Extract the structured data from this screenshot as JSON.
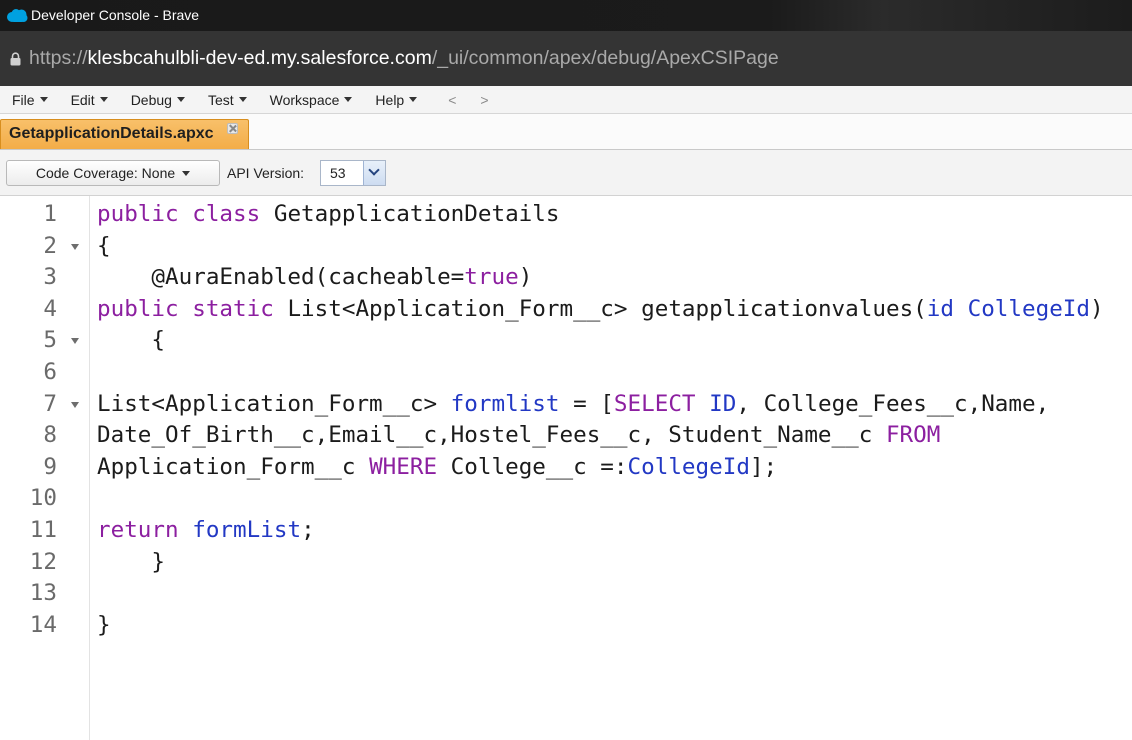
{
  "window": {
    "title": "Developer Console - Brave"
  },
  "address_bar": {
    "scheme": "https://",
    "host": "klesbcahulbli-dev-ed.my.salesforce.com",
    "path": "/_ui/common/apex/debug/ApexCSIPage"
  },
  "menu": {
    "items": [
      {
        "label": "File"
      },
      {
        "label": "Edit"
      },
      {
        "label": "Debug"
      },
      {
        "label": "Test"
      },
      {
        "label": "Workspace"
      },
      {
        "label": "Help"
      }
    ],
    "nav_back": "<",
    "nav_forward": ">"
  },
  "tabs": [
    {
      "label": "GetapplicationDetails.apxc",
      "active": true
    }
  ],
  "toolbar": {
    "coverage_label": "Code Coverage: None",
    "api_version_label": "API Version:",
    "api_version_value": "53"
  },
  "colors": {
    "title_bar": "#1b1b1b",
    "address_bar": "#343434",
    "active_tab": "#f3ad48",
    "keyword": "#8c1fa0",
    "identifier": "#2238c4",
    "code_text": "#1b1b1b",
    "line_number": "#6a6a6a"
  },
  "icons": {
    "app": "salesforce-cloud-icon",
    "address_security": "lock-icon",
    "menu_dropdown": "chevron-down-icon",
    "tab_close": "close-icon",
    "code_fold": "fold-arrow-icon",
    "api_dropdown": "chevron-down-icon"
  },
  "editor": {
    "lines": [
      {
        "number": "1",
        "fold": false,
        "tokens": [
          {
            "text": "public class",
            "color": "#8c1fa0"
          },
          {
            "text": " GetapplicationDetails"
          }
        ]
      },
      {
        "number": "2",
        "fold": true,
        "tokens": [
          {
            "text": "{"
          }
        ]
      },
      {
        "number": "3",
        "fold": false,
        "tokens": [
          {
            "text": "    @AuraEnabled(cacheable="
          },
          {
            "text": "true",
            "color": "#8c1fa0"
          },
          {
            "text": ")"
          }
        ]
      },
      {
        "number": "4",
        "fold": false,
        "tokens": [
          {
            "text": "public static",
            "color": "#8c1fa0"
          },
          {
            "text": " List<Application_Form__c> getapplicationvalues("
          },
          {
            "text": "id CollegeId",
            "color": "#2238c4"
          },
          {
            "text": ")"
          }
        ]
      },
      {
        "number": "5",
        "fold": true,
        "tokens": [
          {
            "text": "    {"
          }
        ]
      },
      {
        "number": "6",
        "fold": false,
        "tokens": []
      },
      {
        "number": "7",
        "fold": true,
        "tokens": [
          {
            "text": "List<Application_Form__c> "
          },
          {
            "text": "formlist",
            "color": "#2238c4"
          },
          {
            "text": " = ["
          },
          {
            "text": "SELECT",
            "color": "#8c1fa0"
          },
          {
            "text": " ID",
            "color": "#2238c4"
          },
          {
            "text": ", College_Fees__c,Name,"
          }
        ]
      },
      {
        "number": "8",
        "fold": false,
        "tokens": [
          {
            "text": "Date_Of_Birth__c,Email__c,Hostel_Fees__c, Student_Name__c "
          },
          {
            "text": "FROM",
            "color": "#8c1fa0"
          }
        ]
      },
      {
        "number": "9",
        "fold": false,
        "tokens": [
          {
            "text": "Application_Form__c "
          },
          {
            "text": "WHERE",
            "color": "#8c1fa0"
          },
          {
            "text": " College__c =:"
          },
          {
            "text": "CollegeId",
            "color": "#2238c4"
          },
          {
            "text": "];"
          }
        ]
      },
      {
        "number": "10",
        "fold": false,
        "tokens": []
      },
      {
        "number": "11",
        "fold": false,
        "tokens": [
          {
            "text": "return",
            "color": "#8c1fa0"
          },
          {
            "text": " formList",
            "color": "#2238c4"
          },
          {
            "text": ";"
          }
        ]
      },
      {
        "number": "12",
        "fold": false,
        "tokens": [
          {
            "text": "    }"
          }
        ]
      },
      {
        "number": "13",
        "fold": false,
        "tokens": []
      },
      {
        "number": "14",
        "fold": false,
        "tokens": [
          {
            "text": "}"
          }
        ]
      }
    ]
  }
}
